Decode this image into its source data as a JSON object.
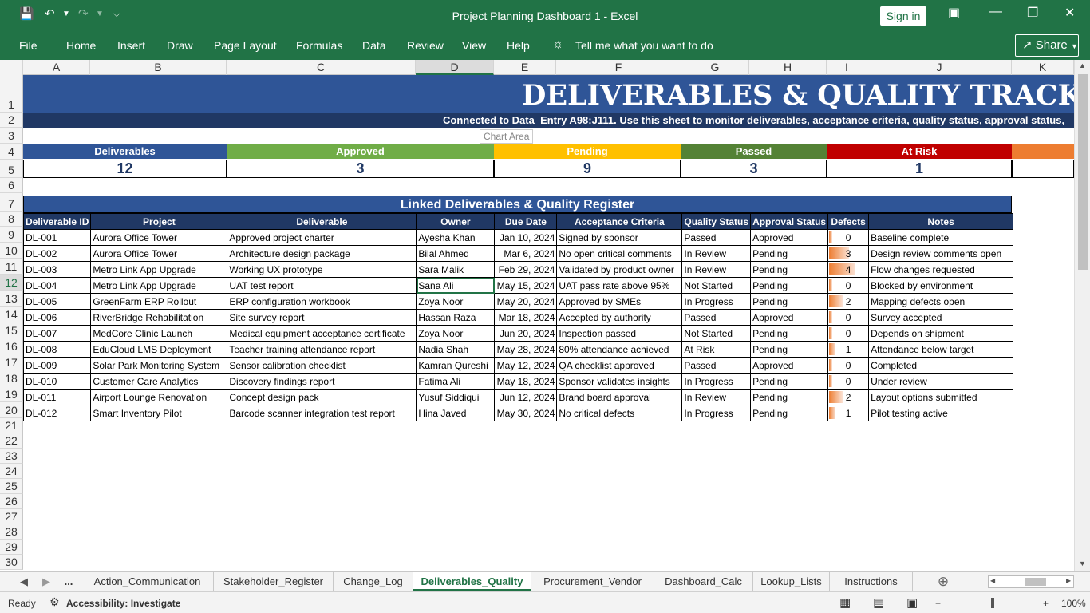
{
  "window": {
    "title": "Project Planning Dashboard 1  -  Excel",
    "sign_in": "Sign in",
    "share": "Share"
  },
  "ribbon": {
    "tabs": [
      "File",
      "Home",
      "Insert",
      "Draw",
      "Page Layout",
      "Formulas",
      "Data",
      "Review",
      "View",
      "Help"
    ],
    "tell_me": "Tell me what you want to do"
  },
  "grid": {
    "columns": [
      "A",
      "B",
      "C",
      "D",
      "E",
      "F",
      "G",
      "H",
      "I",
      "J",
      "K"
    ],
    "rows": [
      "1",
      "2",
      "3",
      "4",
      "5",
      "6",
      "7",
      "8",
      "9",
      "10",
      "11",
      "12",
      "13",
      "14",
      "15",
      "16",
      "17",
      "18",
      "19",
      "20",
      "21",
      "22",
      "23",
      "24",
      "25",
      "26",
      "27",
      "28",
      "29",
      "30"
    ],
    "selected_column": "D",
    "selected_row": "12"
  },
  "sheet": {
    "title": "DELIVERABLES & QUALITY TRACKER",
    "subtitle": "Connected to Data_Entry A98:J111. Use this sheet to monitor deliverables, acceptance criteria, quality status, approval status,",
    "tooltip": "Chart Area"
  },
  "kpis": [
    {
      "label": "Deliverables",
      "value": "12",
      "color": "#2f5597"
    },
    {
      "label": "Approved",
      "value": "3",
      "color": "#70ad47"
    },
    {
      "label": "Pending",
      "value": "9",
      "color": "#ffc000"
    },
    {
      "label": "Passed",
      "value": "3",
      "color": "#548235"
    },
    {
      "label": "At Risk",
      "value": "1",
      "color": "#c00000"
    },
    {
      "label": "",
      "value": "",
      "color": "#ed7d31"
    }
  ],
  "register": {
    "title": "Linked Deliverables & Quality Register",
    "headers": [
      "Deliverable ID",
      "Project",
      "Deliverable",
      "Owner",
      "Due Date",
      "Acceptance Criteria",
      "Quality Status",
      "Approval Status",
      "Defects",
      "Notes"
    ],
    "defect_max": 4,
    "rows": [
      [
        "DL-001",
        "Aurora Office Tower",
        "Approved project charter",
        "Ayesha Khan",
        "Jan 10, 2024",
        "Signed by sponsor",
        "Passed",
        "Approved",
        0,
        "Baseline complete"
      ],
      [
        "DL-002",
        "Aurora Office Tower",
        "Architecture design package",
        "Bilal Ahmed",
        "Mar 6, 2024",
        "No open critical comments",
        "In Review",
        "Pending",
        3,
        "Design review comments open"
      ],
      [
        "DL-003",
        "Metro Link App Upgrade",
        "Working UX prototype",
        "Sara Malik",
        "Feb 29, 2024",
        "Validated by product owner",
        "In Review",
        "Pending",
        4,
        "Flow changes requested"
      ],
      [
        "DL-004",
        "Metro Link App Upgrade",
        "UAT test report",
        "Sana Ali",
        "May 15, 2024",
        "UAT pass rate above 95%",
        "Not Started",
        "Pending",
        0,
        "Blocked by environment"
      ],
      [
        "DL-005",
        "GreenFarm ERP Rollout",
        "ERP configuration workbook",
        "Zoya Noor",
        "May 20, 2024",
        "Approved by SMEs",
        "In Progress",
        "Pending",
        2,
        "Mapping defects open"
      ],
      [
        "DL-006",
        "RiverBridge Rehabilitation",
        "Site survey report",
        "Hassan Raza",
        "Mar 18, 2024",
        "Accepted by authority",
        "Passed",
        "Approved",
        0,
        "Survey accepted"
      ],
      [
        "DL-007",
        "MedCore Clinic Launch",
        "Medical equipment acceptance certificate",
        "Zoya Noor",
        "Jun 20, 2024",
        "Inspection passed",
        "Not Started",
        "Pending",
        0,
        "Depends on shipment"
      ],
      [
        "DL-008",
        "EduCloud LMS Deployment",
        "Teacher training attendance report",
        "Nadia Shah",
        "May 28, 2024",
        "80% attendance achieved",
        "At Risk",
        "Pending",
        1,
        "Attendance below target"
      ],
      [
        "DL-009",
        "Solar Park Monitoring System",
        "Sensor calibration checklist",
        "Kamran Qureshi",
        "May 12, 2024",
        "QA checklist approved",
        "Passed",
        "Approved",
        0,
        "Completed"
      ],
      [
        "DL-010",
        "Customer Care Analytics",
        "Discovery findings report",
        "Fatima Ali",
        "May 18, 2024",
        "Sponsor validates insights",
        "In Progress",
        "Pending",
        0,
        "Under review"
      ],
      [
        "DL-011",
        "Airport Lounge Renovation",
        "Concept design pack",
        "Yusuf Siddiqui",
        "Jun 12, 2024",
        "Brand board approval",
        "In Review",
        "Pending",
        2,
        "Layout options submitted"
      ],
      [
        "DL-012",
        "Smart Inventory Pilot",
        "Barcode scanner integration test report",
        "Hina Javed",
        "May 30, 2024",
        "No critical defects",
        "In Progress",
        "Pending",
        1,
        "Pilot testing active"
      ]
    ]
  },
  "sheet_tabs": {
    "more": "...",
    "tabs": [
      "Action_Communication",
      "Stakeholder_Register",
      "Change_Log",
      "Deliverables_Quality",
      "Procurement_Vendor",
      "Dashboard_Calc",
      "Lookup_Lists",
      "Instructions"
    ],
    "active": "Deliverables_Quality"
  },
  "status": {
    "ready": "Ready",
    "accessibility": "Accessibility: Investigate",
    "zoom": "100%"
  }
}
